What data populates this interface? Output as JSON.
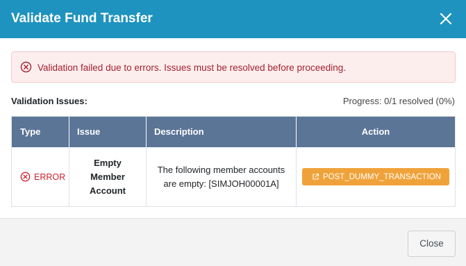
{
  "dialog": {
    "title": "Validate Fund Transfer",
    "close_icon": "close-icon"
  },
  "alert": {
    "icon": "error-circle-icon",
    "message": "Validation failed due to errors. Issues must be resolved before proceeding.",
    "color": "#a42130",
    "background": "#fdeeee"
  },
  "issues": {
    "label": "Validation Issues:",
    "progress": "Progress: 0/1 resolved (0%)",
    "progress_fraction": 0
  },
  "table": {
    "columns": [
      "Type",
      "Issue",
      "Description",
      "Action"
    ],
    "rows": [
      {
        "type_icon": "error-circle-icon",
        "type": "ERROR",
        "issue": "Empty Member Account",
        "description": "The following member accounts are empty: [SIMJOH00001A]",
        "action_icon": "external-link-icon",
        "action": "POST_DUMMY_TRANSACTION"
      }
    ]
  },
  "footer": {
    "close_label": "Close"
  },
  "colors": {
    "header": "#1f93bf",
    "table_header": "#5b7597",
    "error": "#c8202f",
    "action_button": "#f0a23a"
  }
}
